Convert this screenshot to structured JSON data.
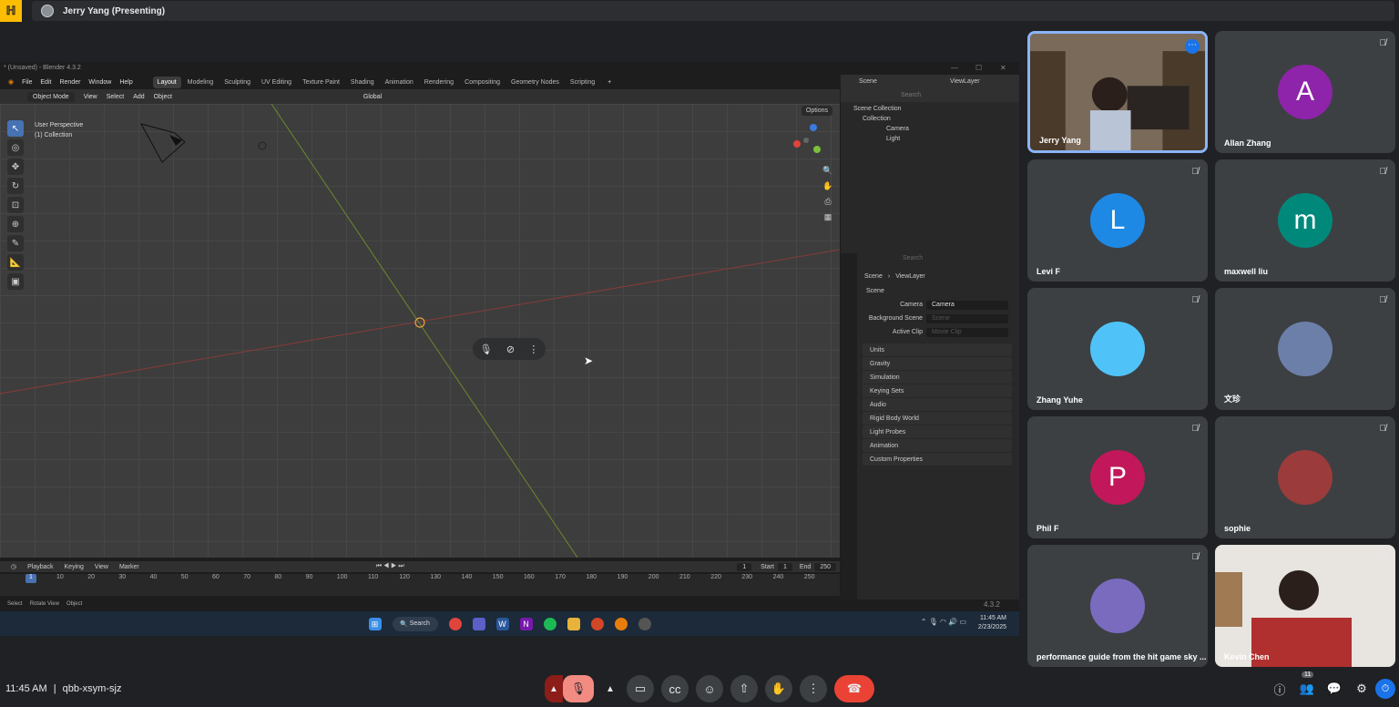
{
  "meeting": {
    "presenter_label": "Jerry Yang (Presenting)",
    "time": "11:45 AM",
    "code": "qbb-xsym-sjz",
    "participant_count": "11"
  },
  "blender": {
    "window_title": "* (Unsaved) - Blender 4.3.2",
    "menus": [
      "File",
      "Edit",
      "Render",
      "Window",
      "Help"
    ],
    "workspaces": [
      "Layout",
      "Modeling",
      "Sculpting",
      "UV Editing",
      "Texture Paint",
      "Shading",
      "Animation",
      "Rendering",
      "Compositing",
      "Geometry Nodes",
      "Scripting"
    ],
    "header": {
      "mode": "Object Mode",
      "view": "View",
      "select": "Select",
      "add": "Add",
      "object": "Object",
      "orientation": "Global"
    },
    "viewport": {
      "label_line1": "User Perspective",
      "label_line2": "(1) Collection",
      "options": "Options"
    },
    "outliner": {
      "scene": "Scene",
      "view_layer": "ViewLayer",
      "search_placeholder": "Search",
      "root": "Scene Collection",
      "collection": "Collection",
      "items": [
        "Camera",
        "Light"
      ]
    },
    "properties": {
      "search_placeholder": "Search",
      "crumb_scene": "Scene",
      "crumb_viewlayer": "ViewLayer",
      "section_scene": "Scene",
      "camera_label": "Camera",
      "camera_value": "Camera",
      "bg_scene_label": "Background Scene",
      "bg_scene_placeholder": "Scene",
      "active_clip_label": "Active Clip",
      "active_clip_placeholder": "Movie Clip",
      "sections": [
        "Units",
        "Gravity",
        "Simulation",
        "Keying Sets",
        "Audio",
        "Rigid Body World",
        "Light Probes",
        "Animation",
        "Custom Properties"
      ]
    },
    "timeline": {
      "menus": [
        "Playback",
        "Keying",
        "View",
        "Marker"
      ],
      "current_frame": "1",
      "start_label": "Start",
      "start": "1",
      "end_label": "End",
      "end": "250",
      "ticks": [
        "10",
        "20",
        "30",
        "40",
        "50",
        "60",
        "70",
        "80",
        "90",
        "100",
        "110",
        "120",
        "130",
        "140",
        "150",
        "160",
        "170",
        "180",
        "190",
        "200",
        "210",
        "220",
        "230",
        "240",
        "250"
      ]
    },
    "statusbar": {
      "select": "Select",
      "rotate": "Rotate View",
      "object": "Object",
      "version": "4.3.2"
    }
  },
  "windows_taskbar": {
    "search": "Search",
    "time": "11:45 AM",
    "date": "2/23/2025"
  },
  "participants": [
    {
      "name": "Jerry Yang",
      "initial": "",
      "color": "#6b5a4a"
    },
    {
      "name": "Allan Zhang",
      "initial": "A",
      "color": "#8e24aa"
    },
    {
      "name": "Levi F",
      "initial": "L",
      "color": "#1e88e5"
    },
    {
      "name": "maxwell liu",
      "initial": "m",
      "color": "#00897b"
    },
    {
      "name": "Zhang Yuhe",
      "initial": "",
      "color": "#4fc3f7"
    },
    {
      "name": "文珍",
      "initial": "",
      "color": "#6c7fa8"
    },
    {
      "name": "Phil F",
      "initial": "P",
      "color": "#c2185b"
    },
    {
      "name": "sophie",
      "initial": "",
      "color": "#9c3b3b"
    },
    {
      "name": "performance guide from the hit game sky ...",
      "initial": "",
      "color": "#7a6bbf"
    },
    {
      "name": "Kevin Chen",
      "initial": "",
      "color": "#b0302f"
    }
  ]
}
